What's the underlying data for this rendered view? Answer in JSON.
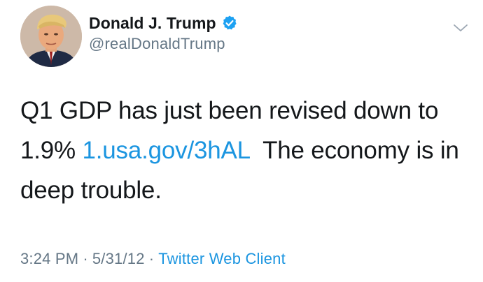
{
  "author": {
    "display_name": "Donald J. Trump",
    "handle": "@realDonaldTrump",
    "verified": true,
    "avatar_icon": "profile-photo"
  },
  "tweet": {
    "line1": "Q1 GDP has just been revised down to",
    "line2_prefix": "1.9% ",
    "link_text": "1.usa.gov/3hAL",
    "line2_suffix": "  The economy is in",
    "line3": "deep trouble."
  },
  "meta": {
    "time": "3:24 PM",
    "separator": "·",
    "date": "5/31/12",
    "client": "Twitter Web Client"
  },
  "icons": {
    "verified": "verified-badge-icon",
    "menu": "chevron-down-icon"
  },
  "colors": {
    "link": "#1b95e0",
    "secondary_text": "#657786",
    "primary_text": "#14171a",
    "verified_badge": "#1da1f2"
  }
}
